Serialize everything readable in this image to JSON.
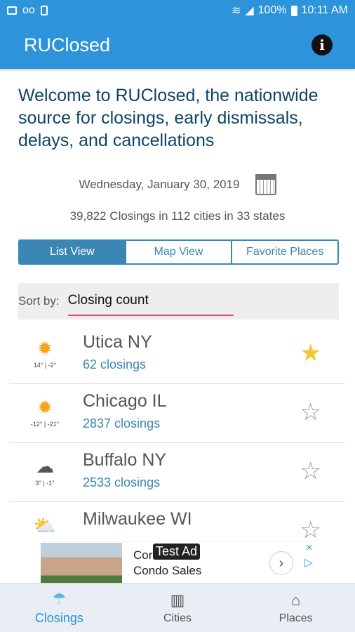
{
  "status_bar": {
    "battery": "100%",
    "time": "10:11 AM",
    "icons": [
      "image-icon",
      "voicemail-icon",
      "sd-card-icon",
      "wifi-icon",
      "signal-icon",
      "battery-icon"
    ]
  },
  "app_bar": {
    "title": "RUClosed",
    "info_icon": "i"
  },
  "welcome_text": "Welcome to RUClosed, the nationwide source for closings, early dismissals, delays, and cancellations",
  "date": "Wednesday, January 30, 2019",
  "summary": "39,822 Closings in 112 cities in 33 states",
  "view_tabs": [
    {
      "label": "List View",
      "active": true
    },
    {
      "label": "Map View",
      "active": false
    },
    {
      "label": "Favorite Places",
      "active": false
    }
  ],
  "sort": {
    "label": "Sort by:",
    "value": "Closing count"
  },
  "cities": [
    {
      "name": "Utica NY",
      "closings": "62 closings",
      "temp": "14° | -2°",
      "weather": "sun-icon",
      "favorite": true
    },
    {
      "name": "Chicago IL",
      "closings": "2837 closings",
      "temp": "-12° | -21°",
      "weather": "sun-icon",
      "favorite": false
    },
    {
      "name": "Buffalo NY",
      "closings": "2533 closings",
      "temp": "3° | -1°",
      "weather": "snow-icon",
      "favorite": false
    },
    {
      "name": "Milwaukee WI",
      "closings": "",
      "temp": "",
      "weather": "partly-cloudy-icon",
      "favorite": false
    }
  ],
  "ad": {
    "line1": "Cor",
    "badge": "Test Ad",
    "line2": "Condo Sales"
  },
  "bottom_nav": [
    {
      "label": "Closings",
      "icon": "closings-icon",
      "active": true
    },
    {
      "label": "Cities",
      "icon": "cities-icon",
      "active": false
    },
    {
      "label": "Places",
      "icon": "places-icon",
      "active": false
    }
  ],
  "colors": {
    "primary": "#2d93db",
    "tab_accent": "#3a86b4",
    "sort_underline": "#e0457b",
    "favorite_star": "#f3c733",
    "heading": "#0e4466"
  }
}
